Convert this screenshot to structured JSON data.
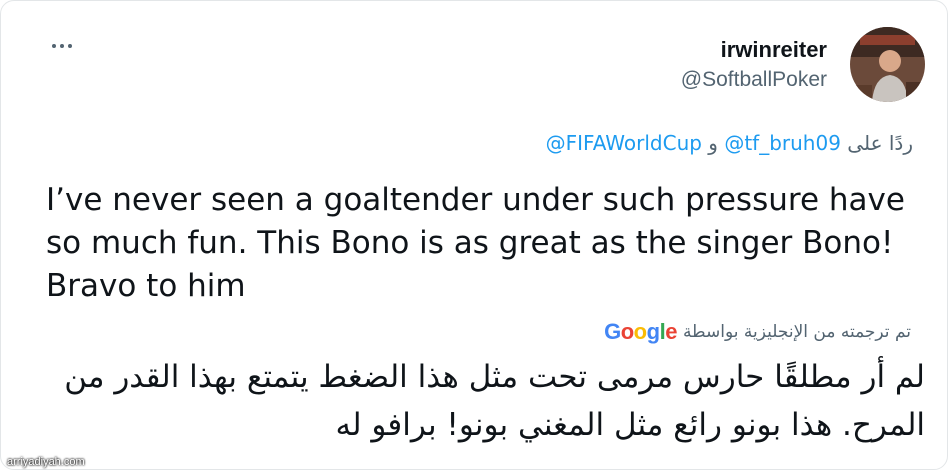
{
  "tweet": {
    "display_name": "irwinreiter",
    "handle": "@SoftballPoker",
    "reply_prefix": "ردًا على",
    "reply_mention_1": "@tf_bruh09",
    "reply_conjunction": "و",
    "reply_mention_2": "@FIFAWorldCup",
    "text": "I’ve never seen a goaltender under such pressure have so much fun.  This Bono is as great as the singer Bono! Bravo to him",
    "translated_by": "تم ترجمته من الإنجليزية بواسطة",
    "translation_provider": "Google",
    "translation": "لم أر مطلقًا حارس مرمى تحت مثل هذا الضغط يتمتع بهذا القدر من المرح. هذا بونو رائع مثل المغني بونو! برافو له"
  },
  "colors": {
    "link": "#1d9bf0",
    "secondary": "#536471",
    "google_blue": "#4285F4",
    "google_red": "#EA4335",
    "google_yellow": "#FBBC05",
    "google_green": "#34A853"
  },
  "icons": {
    "more": "more-horizontal-icon"
  },
  "watermark": "arriyadiyah.com"
}
